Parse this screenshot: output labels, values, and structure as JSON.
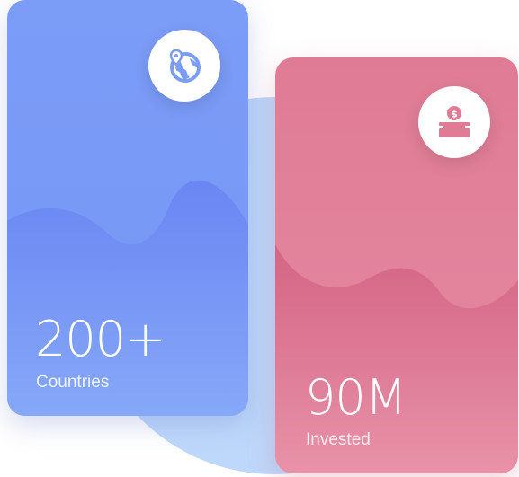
{
  "cards": [
    {
      "value": "200+",
      "label": "Countries",
      "icon": "globe-location-icon",
      "color": "#7b9cf7"
    },
    {
      "value": "90M",
      "label": "Invested",
      "icon": "donation-box-icon",
      "color": "#e07b95"
    }
  ],
  "colors": {
    "accent_blue": "#7b9cf7",
    "accent_pink": "#e07b95",
    "background_circle": "#bed8fb",
    "icon_fill_blue": "#7b9cf7",
    "icon_fill_pink": "#e07b95"
  }
}
